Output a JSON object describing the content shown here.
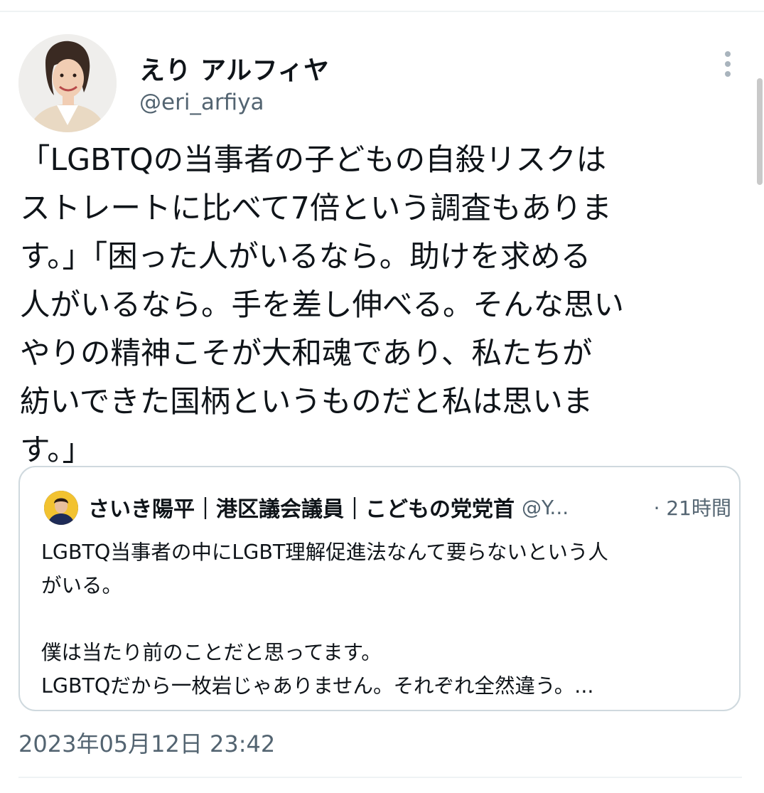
{
  "author": {
    "display_name": "えり アルフィヤ",
    "handle": "@eri_arfiya",
    "avatar_icon": "profile-photo"
  },
  "tweet": {
    "text": " 「LGBTQの当事者の子どもの自殺リスクは\nストレートに比べて7倍という調査もありま\nす。」「困った人がいるなら。助けを求める\n人がいるなら。手を差し伸べる。そんな思い\nやりの精神こそが大和魂であり、私たちが\n紡いできた国柄というものだと私は思いま\nす。」",
    "timestamp": "2023年05月12日 23:42"
  },
  "quoted_tweet": {
    "display_name": "さいき陽平｜港区議会議員｜こどもの党党首",
    "handle": "@Y...",
    "time": "· 21時間",
    "text": "LGBTQ当事者の中にLGBT理解促進法なんて要らないという人\nがいる。\n\n僕は当たり前のことだと思ってます。\nLGBTQだから一枚岩じゃありません。それぞれ全然違う。..."
  },
  "colors": {
    "text_primary": "#0f1419",
    "text_secondary": "#536471",
    "border": "#cfd9de",
    "divider": "#eff3f4"
  }
}
